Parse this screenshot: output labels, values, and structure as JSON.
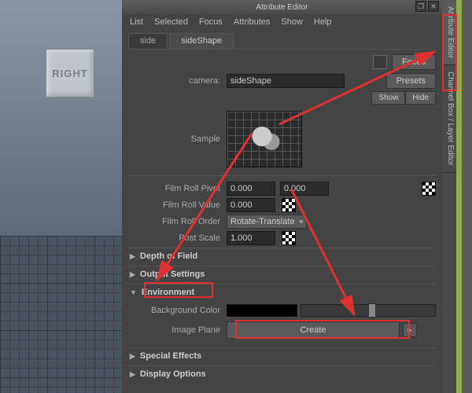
{
  "viewport": {
    "cube_label": "RIGHT"
  },
  "window": {
    "title": "Attribute Editor"
  },
  "menu": {
    "list": "List",
    "selected": "Selected",
    "focus": "Focus",
    "attributes": "Attributes",
    "show": "Show",
    "help": "Help"
  },
  "tabs": {
    "side": "side",
    "sideShape": "sideShape"
  },
  "buttons": {
    "focus": "Focus",
    "presets": "Presets",
    "show": "Show",
    "hide": "Hide",
    "create": "Create"
  },
  "labels": {
    "camera": "camera:",
    "sample": "Sample",
    "film_roll_pivot": "Film Roll Pivot",
    "film_roll_value": "Film Roll Value",
    "film_roll_order": "Film Roll Order",
    "post_scale": "Post Scale",
    "depth_of_field": "Depth of Field",
    "output_settings": "Output Settings",
    "environment": "Environment",
    "background_color": "Background Color",
    "image_plane": "Image Plane",
    "special_effects": "Special Effects",
    "display_options": "Display Options"
  },
  "values": {
    "camera": "sideShape",
    "pivot_x": "0.000",
    "pivot_y": "0.000",
    "roll_value": "0.000",
    "roll_order": "Rotate-Translate",
    "post_scale": "1.000"
  },
  "side_tabs": {
    "attr": "Attribute Editor",
    "channel": "Channel Box / Layer Editor"
  }
}
